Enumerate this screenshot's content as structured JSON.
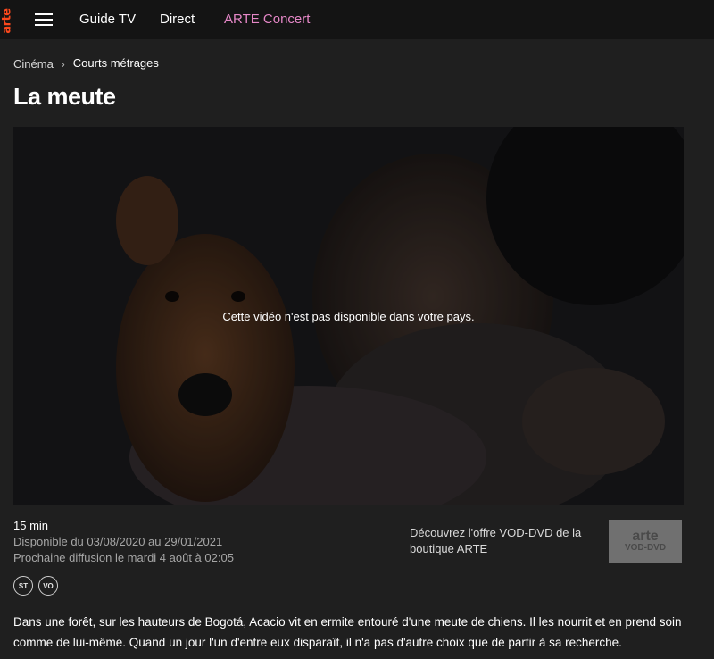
{
  "brand": {
    "logo_text": "arte"
  },
  "nav": {
    "menu_icon": "hamburger-icon",
    "items": [
      "Guide TV",
      "Direct",
      "ARTE Concert"
    ]
  },
  "breadcrumb": {
    "parent": "Cinéma",
    "separator": "›",
    "current": "Courts métrages"
  },
  "page": {
    "title": "La meute"
  },
  "player": {
    "message": "Cette vidéo n'est pas disponible dans votre pays."
  },
  "meta": {
    "duration": "15 min",
    "availability": "Disponible du 03/08/2020 au 29/01/2021",
    "next_broadcast": "Prochaine diffusion le mardi 4 août à 02:05",
    "badges": [
      "ST",
      "VO"
    ]
  },
  "vod": {
    "text": "Découvrez l'offre VOD-DVD de la boutique ARTE",
    "logo_brand": "arte",
    "logo_sub": "VOD-DVD"
  },
  "synopsis": "Dans une forêt, sur les hauteurs de Bogotá, Acacio vit en ermite entouré d'une meute de chiens. Il les nourrit et en prend soin comme de lui-même. Quand un jour l'un d'entre eux disparaît, il n'a pas d'autre choix que de partir à sa recherche.",
  "colors": {
    "accent": "#fa481c",
    "concert": "#e587c7",
    "background": "#1f1f1f"
  }
}
